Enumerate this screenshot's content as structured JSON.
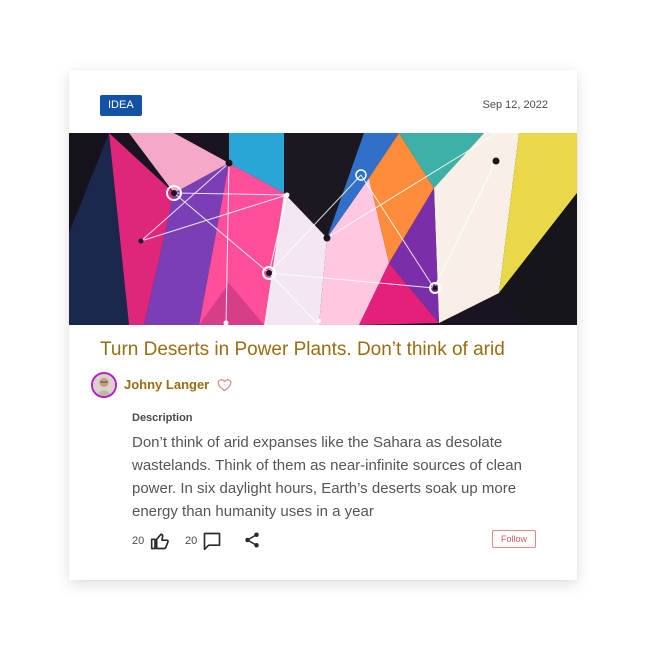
{
  "card": {
    "tag": "IDEA",
    "date": "Sep 12, 2022",
    "title": "Turn Deserts in Power Plants. Don’t think of arid",
    "author": {
      "name": "Johny Langer"
    },
    "description": {
      "label": "Description",
      "text": "Don’t think of arid expanses like the Sahara as desolate wastelands. Think of them as near-infinite sources of clean power. In six daylight hours, Earth’s deserts soak up more energy than humanity uses in a year"
    },
    "stats": {
      "likes": "20",
      "comments": "20"
    },
    "follow_label": "Follow"
  },
  "icons": [
    "heart-icon",
    "thumbs-up-icon",
    "comment-icon",
    "share-icon"
  ],
  "colors": {
    "tag_bg": "#1452a8",
    "title": "#9a6d12",
    "author": "#9a6d12",
    "follow": "#e05c5c",
    "avatar_ring": "#b520c8"
  }
}
